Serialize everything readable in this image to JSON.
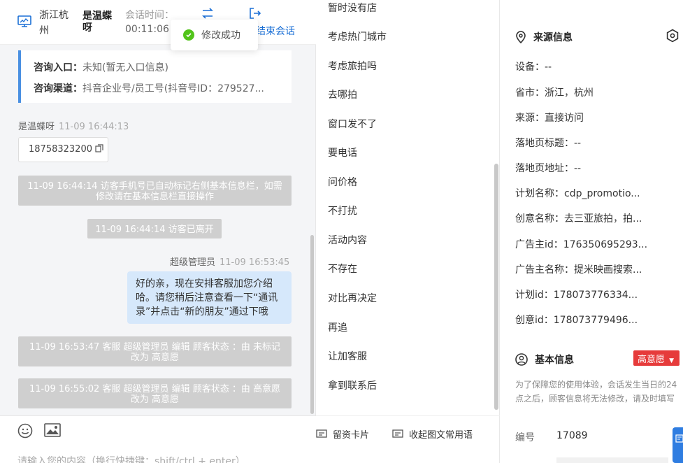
{
  "header": {
    "location": "浙江杭州",
    "visitor_name": "是温蝶呀",
    "time_label": "会话时间：",
    "time_value": "00:11:06",
    "end_label": "结束会话",
    "toast": "修改成功"
  },
  "info_card": {
    "entry_label": "咨询入口：",
    "entry_value": "未知(暂无入口信息)",
    "channel_label": "咨询渠道：",
    "channel_value": "抖音企业号/员工号(抖音号ID：279527..."
  },
  "messages": {
    "visitor_name": "是温蝶呀",
    "visitor_time": "11-09 16:44:13",
    "phone": "18758323200",
    "sys1": "11-09 16:44:14 访客手机号已自动标记右侧基本信息栏，如需修改请在基本信息栏直接操作",
    "sys2": "11-09 16:44:14 访客已离开",
    "agent_name": "超级管理员",
    "agent_time": "11-09 16:53:45",
    "agent_msg": "好的亲，现在安排客服加您介绍哈。请您稍后注意查看一下“通讯录”并点击“新的朋友”通过下哦",
    "sys3": "11-09 16:53:47 客服 超级管理员 编辑 顾客状态 ：由 未标记 改为 高意愿",
    "sys4": "11-09 16:55:02 客服 超级管理员 编辑 顾客状态 ：由 高意愿 改为 高意愿"
  },
  "composer": {
    "placeholder": "请输入您的内容（换行快捷键：shift/ctrl + enter）"
  },
  "phrases": [
    "暂时没有店",
    "考虑热门城市",
    "考虑旅拍吗",
    "去哪拍",
    "窗口发不了",
    "要电话",
    "问价格",
    "不打扰",
    "活动内容",
    "不存在",
    "对比再决定",
    "再追",
    "让加客服",
    "拿到联系后"
  ],
  "mid_footer": {
    "card_label": "留资卡片",
    "common_label": "收起图文常用语"
  },
  "source_info": {
    "title": "来源信息",
    "device": "设备：--",
    "province": "省市：浙江，杭州",
    "source": "来源：直接访问",
    "landing_title": "落地页标题：--",
    "landing_url": "落地页地址：--",
    "plan_name": "计划名称：cdp_promotio...",
    "creative_name": "创意名称：去三亚旅拍，拍...",
    "advertiser_id": "广告主id：176350695293...",
    "advertiser_name": "广告主名称：提米映画搜索...",
    "plan_id": "计划id：178073776334...",
    "creative_id": "创意id：178073779496..."
  },
  "basic_info": {
    "title": "基本信息",
    "status_badge": "高意愿",
    "note": "为了保障您的使用体验，会话发生当日的24点之后，顾客信息将无法修改，请及时填写",
    "id_label": "编号",
    "id_value": "17089"
  },
  "colors": {
    "accent": "#1a6fd6",
    "badge": "#e63b3b",
    "bubble": "#d6e8fb",
    "system_note": "#cfcfcf",
    "success": "#52c41a"
  }
}
